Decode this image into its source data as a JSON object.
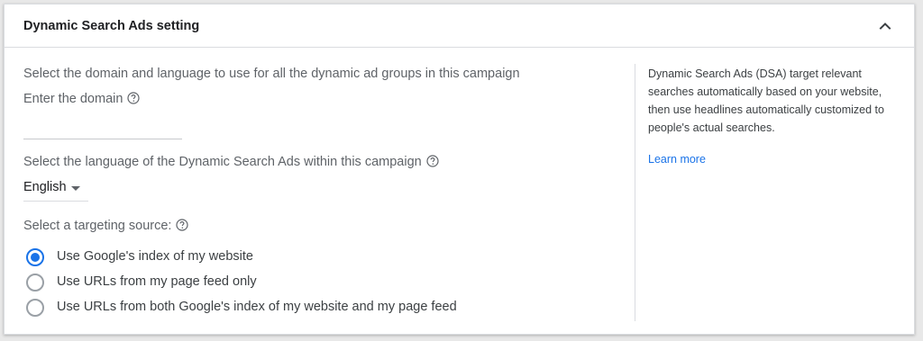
{
  "card": {
    "title": "Dynamic Search Ads setting",
    "collapse_icon": "chevron-up-icon"
  },
  "left": {
    "intro": "Select the domain and language to use for all the dynamic ad groups in this campaign",
    "domain_label": "Enter the domain",
    "domain_value": "",
    "language_label": "Select the language of the Dynamic Search Ads within this campaign",
    "language_selected": "English",
    "targeting_label": "Select a targeting source:",
    "help_icon": "help-circle-icon",
    "options": [
      {
        "label": "Use Google's index of my website",
        "checked": true
      },
      {
        "label": "Use URLs from my page feed only",
        "checked": false
      },
      {
        "label": "Use URLs from both Google's index of my website and my page feed",
        "checked": false
      }
    ]
  },
  "right": {
    "description": "Dynamic Search Ads (DSA) target relevant searches automatically based on your website, then use headlines automatically customized to people's actual searches.",
    "learn_more": "Learn more"
  },
  "colors": {
    "accent": "#1a73e8",
    "text_primary": "#202124",
    "text_secondary": "#5f6368",
    "divider": "#dadce0"
  }
}
